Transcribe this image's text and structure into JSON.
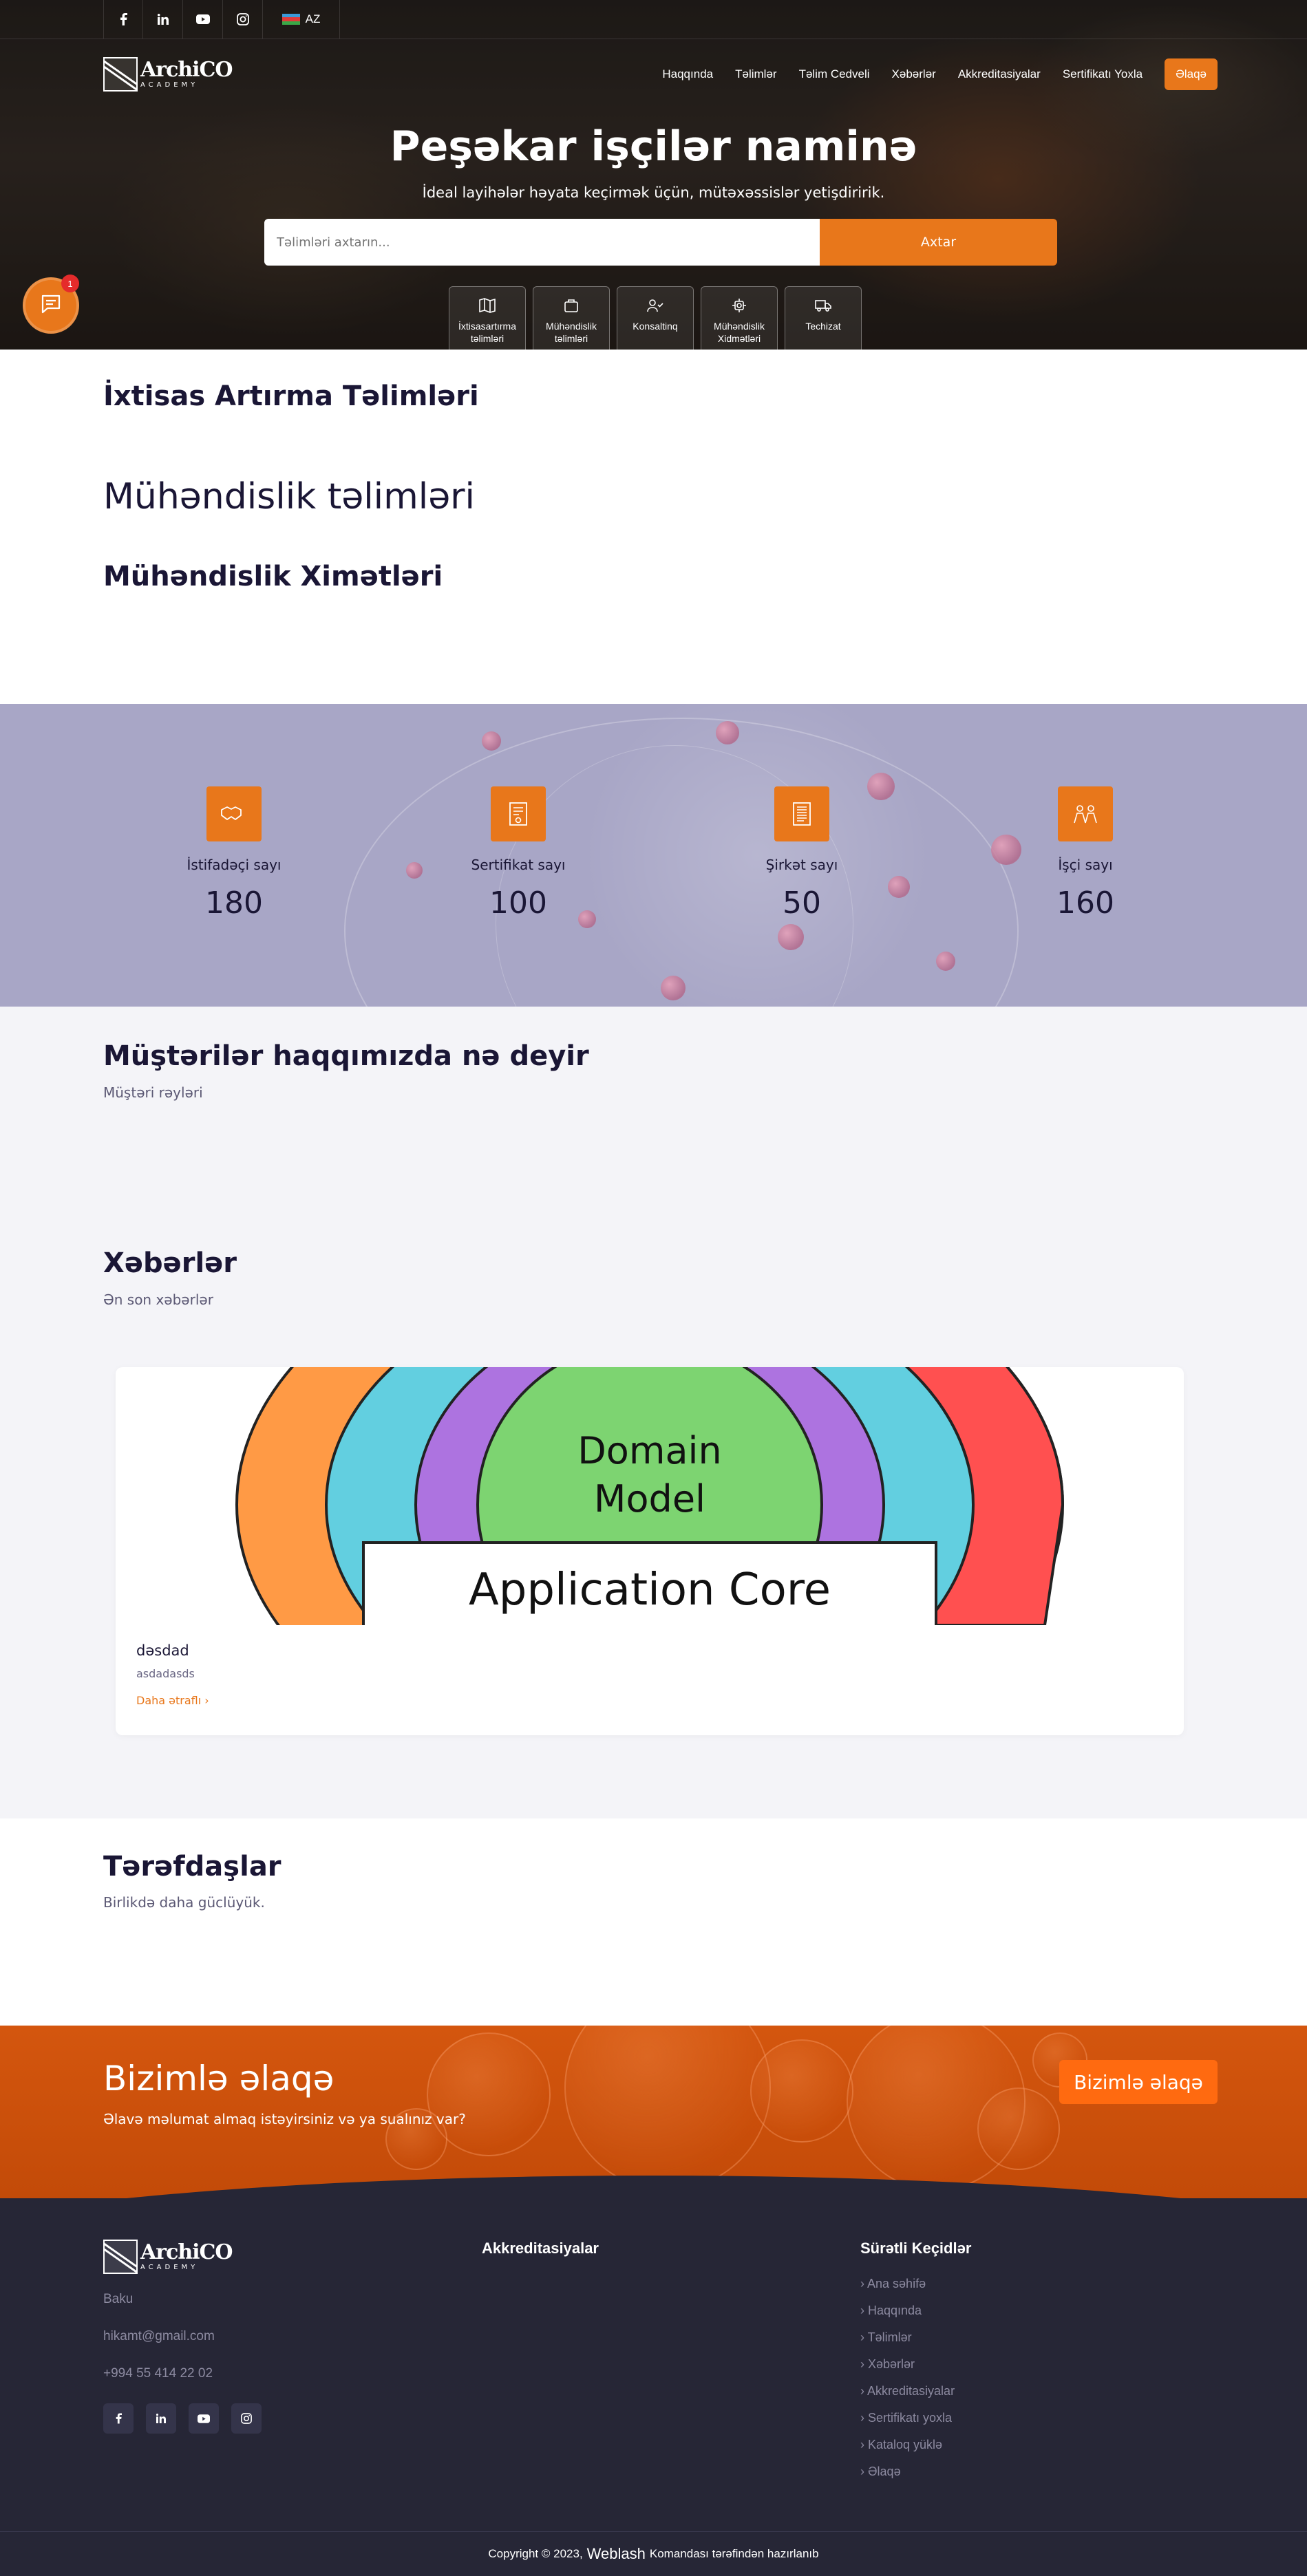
{
  "topbar": {
    "social": [
      {
        "icon": "facebook-icon"
      },
      {
        "icon": "linkedin-icon"
      },
      {
        "icon": "youtube-icon"
      },
      {
        "icon": "instagram-icon"
      }
    ],
    "language": "AZ"
  },
  "logo": {
    "name": "ArchiCO",
    "sub": "ACADEMY"
  },
  "nav": {
    "items": [
      "Haqqında",
      "Təlimlər",
      "Təlim Cedveli",
      "Xəbərlər",
      "Akkreditasiyalar",
      "Sertifikatı Yoxla"
    ],
    "cta": "Əlaqə"
  },
  "hero": {
    "title": "Peşəkar işçilər naminə",
    "subtitle": "İdeal layihələr həyata keçirmək üçün, mütəxəssislər yetişdiririk.",
    "search_placeholder": "Təlimləri axtarın...",
    "search_button": "Axtar",
    "categories": [
      {
        "label": "İxtisasartırma təlimləri",
        "icon": "map-icon"
      },
      {
        "label": "Mühəndislik təlimləri",
        "icon": "briefcase-icon"
      },
      {
        "label": "Konsaltinq",
        "icon": "user-check-icon"
      },
      {
        "label": "Mühəndislik Xidmətləri",
        "icon": "gear-icon"
      },
      {
        "label": "Techizat",
        "icon": "truck-icon"
      }
    ]
  },
  "chat": {
    "badge": "1"
  },
  "sections": {
    "s1": "İxtisas Artırma Təlimləri",
    "s2": "Mühəndislik təlimləri",
    "s3": "Mühəndislik Ximətləri"
  },
  "stats": [
    {
      "label": "İstifadəçi sayı",
      "value": "180",
      "icon": "handshake-icon"
    },
    {
      "label": "Sertifikat sayı",
      "value": "100",
      "icon": "certificate-icon"
    },
    {
      "label": "Şirkət sayı",
      "value": "50",
      "icon": "document-icon"
    },
    {
      "label": "İşçi sayı",
      "value": "160",
      "icon": "team-icon"
    }
  ],
  "testimonials": {
    "title": "Müştərilər haqqımızda nə deyir",
    "subtitle": "Müştəri rəyləri"
  },
  "news": {
    "title": "Xəbərlər",
    "subtitle": "Ən son xəbərlər",
    "card": {
      "image_labels": {
        "model": "Domain Model",
        "core": "Application Core"
      },
      "title": "dəsdad",
      "desc": "asdadasds",
      "more": "Daha ətraflı"
    }
  },
  "partners": {
    "title": "Tərəfdaşlar",
    "subtitle": "Birlikdə daha güclüyük."
  },
  "contact": {
    "title": "Bizimlə əlaqə",
    "subtitle": "Əlavə məlumat almaq istəyirsiniz və ya sualınız var?",
    "button": "Bizimlə əlaqə"
  },
  "footer": {
    "city": "Baku",
    "email": "hikamt@gmail.com",
    "phone": "+994 55 414 22 02",
    "col2_title": "Akkreditasiyalar",
    "col3_title": "Sürətli Keçidlər",
    "links": [
      "Ana səhifə",
      "Haqqında",
      "Təlimlər",
      "Xəbərlər",
      "Akkreditasiyalar",
      "Sertifikatı yoxla",
      "Kataloq yüklə",
      "Əlaqə"
    ],
    "copyright_pre": "Copyright © 2023,",
    "copyright_brand": "Weblash",
    "copyright_post": "Komandası tərəfindən hazırlanıb"
  },
  "colors": {
    "accent": "#e8771b",
    "dark": "#262636",
    "heading": "#1a1635",
    "stats_bg": "#a8a6c6"
  }
}
